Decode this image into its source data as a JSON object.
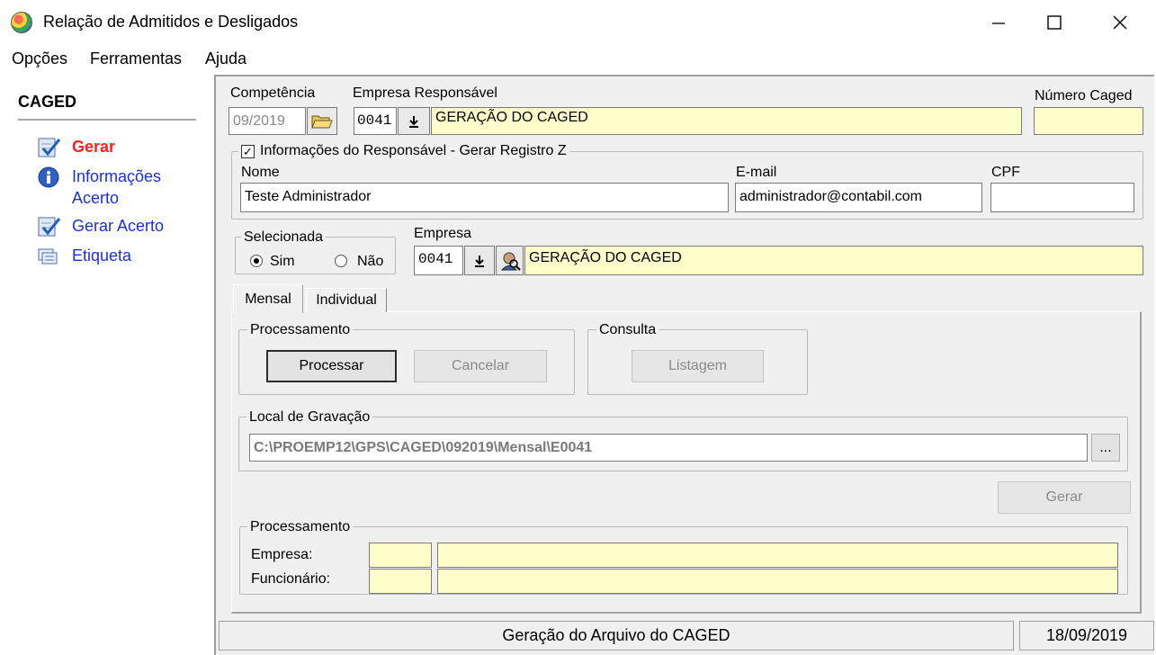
{
  "window": {
    "title": "Relação de Admitidos e Desligados",
    "minimize": "—",
    "maximize": "☐",
    "close": "✕"
  },
  "menu": [
    "Opções",
    "Ferramentas",
    "Ajuda"
  ],
  "sidebar": {
    "title": "CAGED",
    "items": [
      {
        "label": "Gerar",
        "icon": "checklist-icon",
        "active": true
      },
      {
        "label": "Informações",
        "label2": "Acerto",
        "icon": "info-icon"
      },
      {
        "label": "Gerar Acerto",
        "icon": "checklist-icon"
      },
      {
        "label": "Etiqueta",
        "icon": "label-icon"
      }
    ]
  },
  "header": {
    "competencia_label": "Competência",
    "competencia_value": "09/2019",
    "empresa_resp_label": "Empresa Responsável",
    "empresa_resp_code": "0041",
    "empresa_resp_name": "GERAÇÃO DO CAGED",
    "numero_caged_label": "Número Caged",
    "numero_caged_value": ""
  },
  "responsavel": {
    "legend": "Informações do Responsável - Gerar Registro Z",
    "checked": true,
    "nome_label": "Nome",
    "nome_value": "Teste Administrador",
    "email_label": "E-mail",
    "email_value": "administrador@contabil.com",
    "cpf_label": "CPF",
    "cpf_value": ""
  },
  "selecionada": {
    "legend": "Selecionada",
    "sim": "Sim",
    "nao": "Não",
    "selected": "Sim"
  },
  "empresa": {
    "label": "Empresa",
    "code": "0041",
    "name": "GERAÇÃO DO CAGED"
  },
  "tabs": [
    {
      "label": "Mensal",
      "active": true
    },
    {
      "label": "Individual",
      "active": false
    }
  ],
  "processamento": {
    "legend": "Processamento",
    "processar": "Processar",
    "cancelar": "Cancelar"
  },
  "consulta": {
    "legend": "Consulta",
    "listagem": "Listagem"
  },
  "local": {
    "legend": "Local de Gravação",
    "path": "C:\\PROEMP12\\GPS\\CAGED\\092019\\Mensal\\E0041",
    "browse": "..."
  },
  "gerar_button": "Gerar",
  "progresso": {
    "legend": "Processamento",
    "empresa_label": "Empresa:",
    "funcionario_label": "Funcionário:"
  },
  "status": {
    "message": "Geração do Arquivo do CAGED",
    "date": "18/09/2019"
  },
  "colors": {
    "accent_red": "#ff2020",
    "link_blue": "#1a2fe0",
    "field_yellow": "#ffffcc",
    "panel_gray": "#f0f0f0"
  }
}
